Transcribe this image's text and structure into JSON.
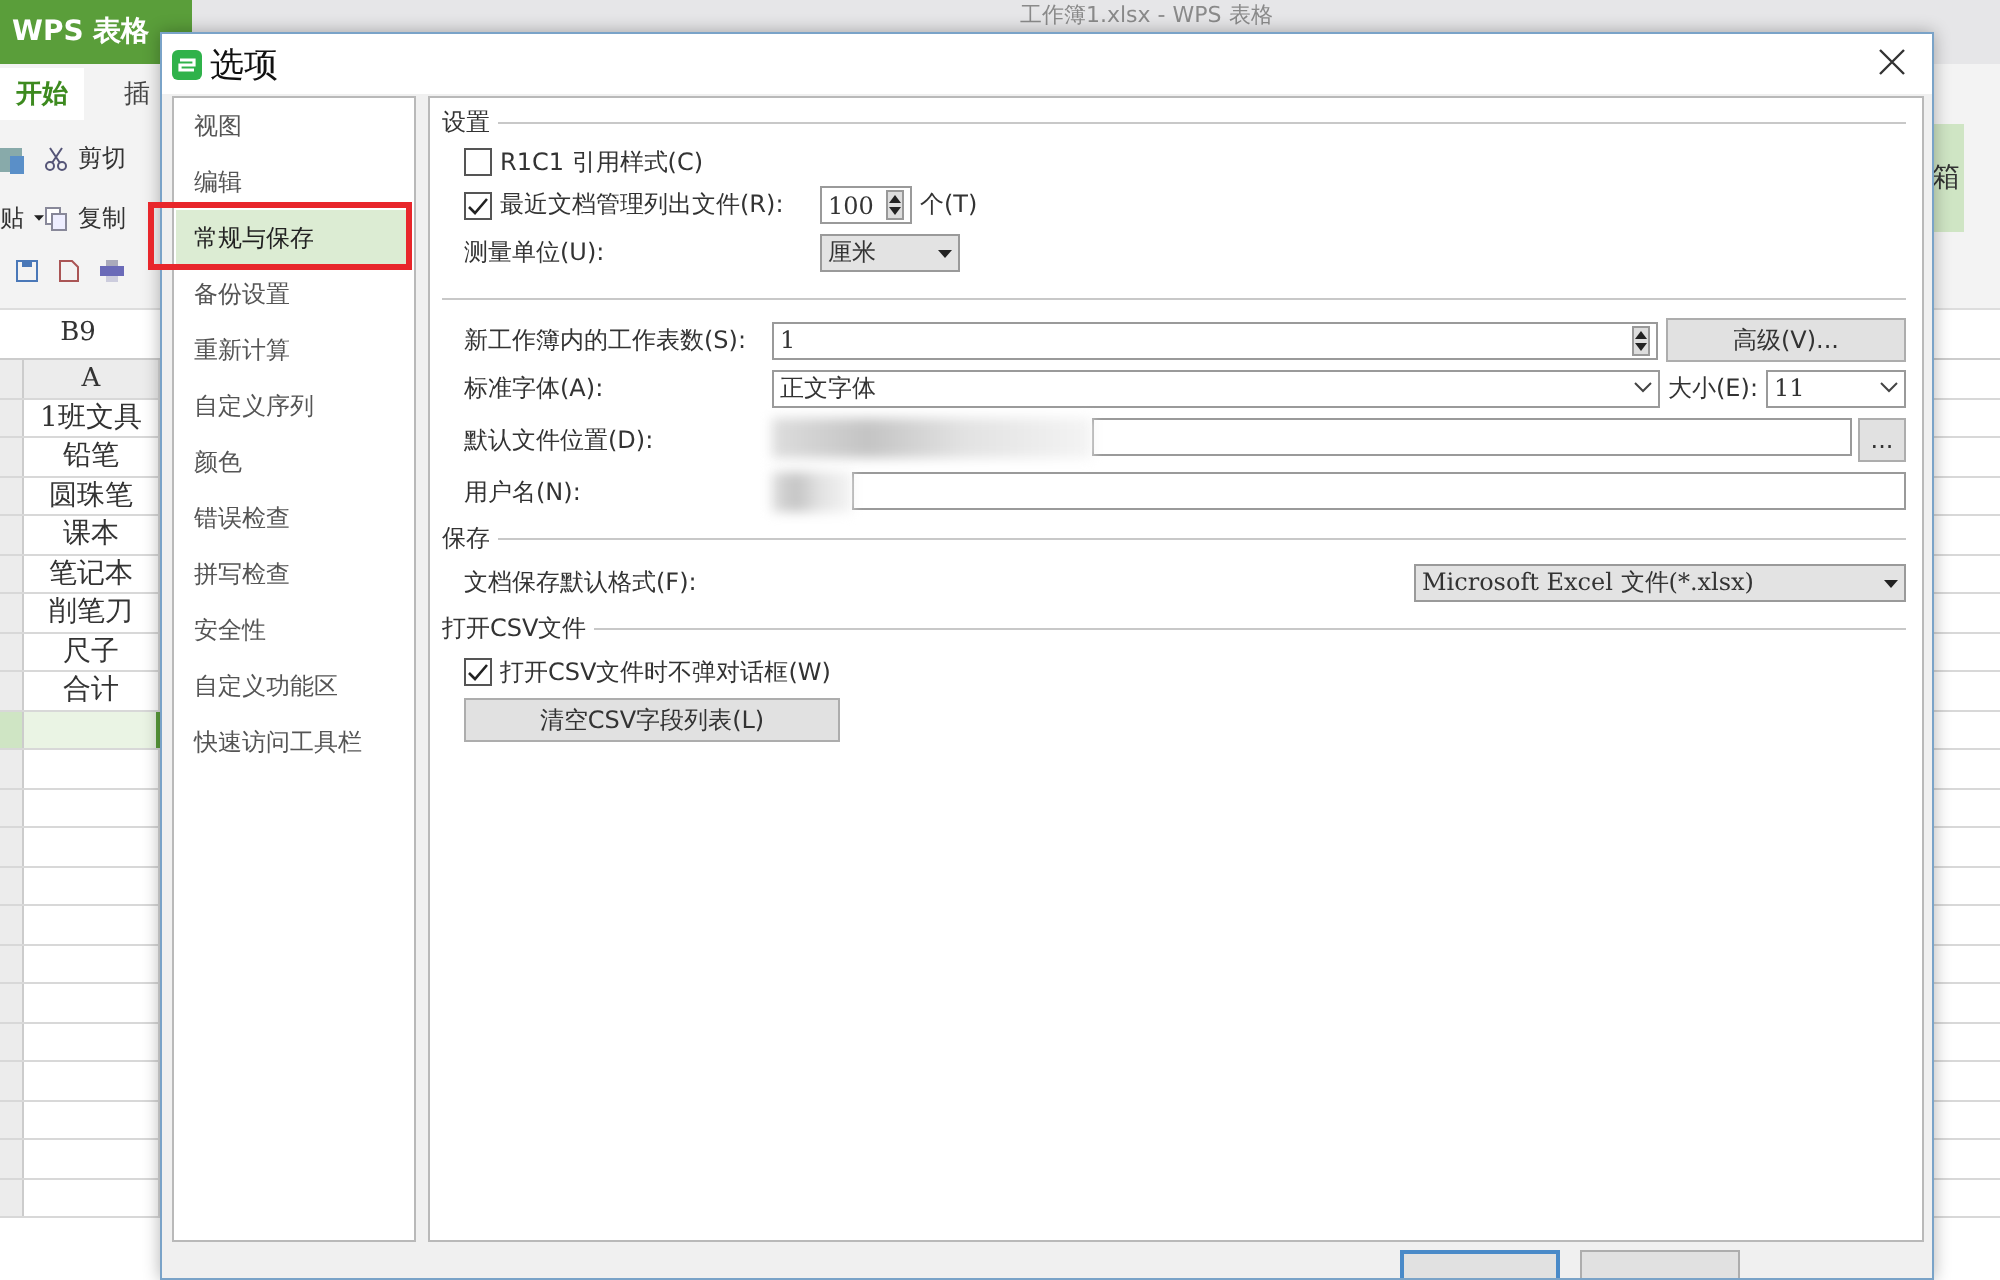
{
  "app": {
    "name": "WPS 表格",
    "document_title": "工作簿1.xlsx - WPS 表格",
    "tabs": [
      {
        "label": "开始",
        "selected": true
      },
      {
        "label": "插",
        "selected": false
      }
    ],
    "commands": [
      {
        "kind": "cut",
        "label": "剪切"
      },
      {
        "kind": "paste",
        "label": "贴"
      },
      {
        "kind": "copy",
        "label": "复制"
      }
    ],
    "ribbon_right_label": "箱",
    "name_box": "B9",
    "column_header": "A",
    "cells": [
      "1班文具",
      "铅笔",
      "圆珠笔",
      "课本",
      "笔记本",
      "削笔刀",
      "尺子",
      "合计"
    ]
  },
  "dialog": {
    "title": "选项",
    "nav": [
      {
        "label": "视图",
        "selected": false
      },
      {
        "label": "编辑",
        "selected": false
      },
      {
        "label": "常规与保存",
        "selected": true
      },
      {
        "label": "备份设置",
        "selected": false
      },
      {
        "label": "重新计算",
        "selected": false
      },
      {
        "label": "自定义序列",
        "selected": false
      },
      {
        "label": "颜色",
        "selected": false
      },
      {
        "label": "错误检查",
        "selected": false
      },
      {
        "label": "拼写检查",
        "selected": false
      },
      {
        "label": "安全性",
        "selected": false
      },
      {
        "label": "自定义功能区",
        "selected": false
      },
      {
        "label": "快速访问工具栏",
        "selected": false
      }
    ],
    "settings": {
      "title": "设置",
      "r1c1": {
        "label": "R1C1 引用样式(C)",
        "checked": false
      },
      "recent": {
        "label": "最近文档管理列出文件(R):",
        "checked": true,
        "value": "100",
        "unit": "个(T)"
      },
      "measure": {
        "label": "测量单位(U):",
        "value": "厘米"
      }
    },
    "workbook": {
      "sheets": {
        "label": "新工作簿内的工作表数(S):",
        "value": "1"
      },
      "advanced_button": "高级(V)...",
      "font": {
        "label": "标准字体(A):",
        "value": "正文字体"
      },
      "size": {
        "label": "大小(E):",
        "value": "11"
      },
      "location": {
        "label": "默认文件位置(D):",
        "browse_button": "..."
      },
      "user": {
        "label": "用户名(N):"
      }
    },
    "save": {
      "title": "保存",
      "format": {
        "label": "文档保存默认格式(F):",
        "value": "Microsoft Excel 文件(*.xlsx)"
      }
    },
    "csv": {
      "title": "打开CSV文件",
      "no_prompt": {
        "label": "打开CSV文件时不弹对话框(W)",
        "checked": true
      },
      "clear_button": "清空CSV字段列表(L)"
    }
  }
}
